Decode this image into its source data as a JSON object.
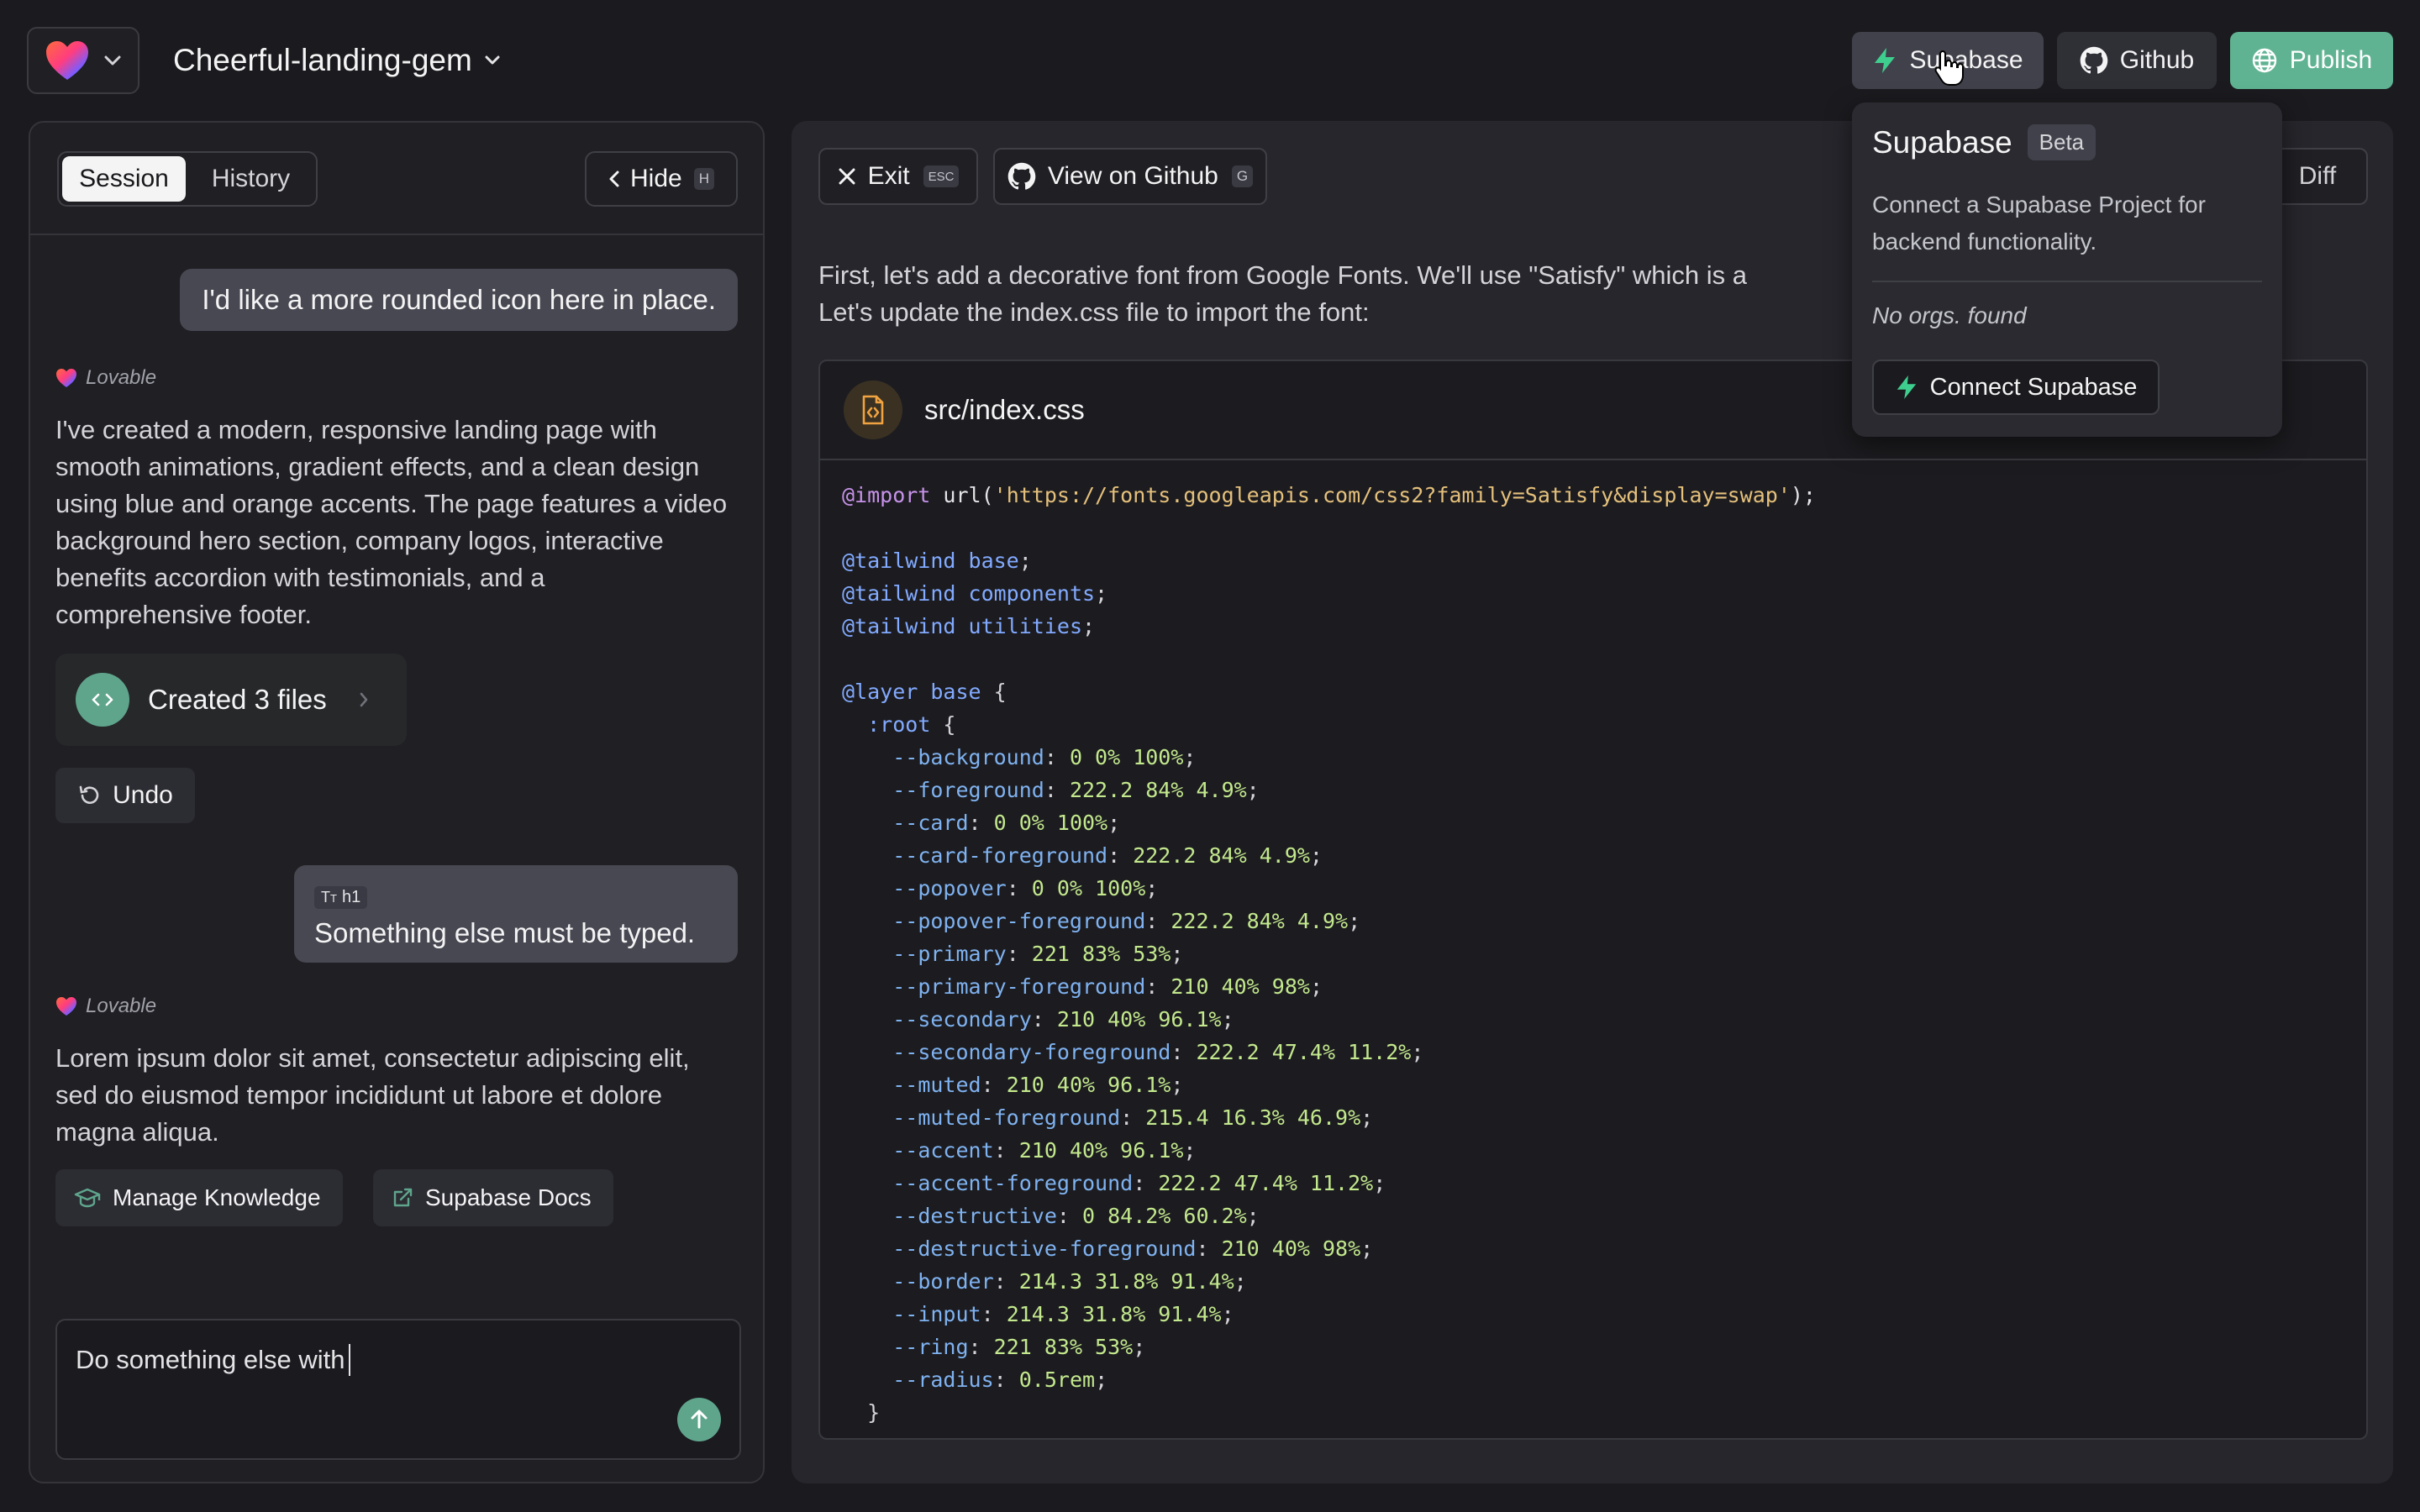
{
  "header": {
    "project_name": "Cheerful-landing-gem",
    "supabase_label": "Supabase",
    "github_label": "Github",
    "publish_label": "Publish"
  },
  "left_panel": {
    "tabs": [
      {
        "label": "Session",
        "active": true
      },
      {
        "label": "History",
        "active": false
      }
    ],
    "hide_label": "Hide",
    "hide_shortcut": "H",
    "messages": {
      "user1": "I'd like a more rounded icon here in place.",
      "sender1": "Lovable",
      "assistant1": "I've created a modern, responsive landing page with smooth animations, gradient effects, and a clean design using blue and orange accents. The  page features a video background hero section, company logos, interactive benefits accordion with testimonials, and a comprehensive footer.",
      "files_card": "Created 3 files",
      "undo_label": "Undo",
      "user2_tag": "h1",
      "user2": "Something else must be typed.",
      "sender2": "Lovable",
      "assistant2": "Lorem ipsum dolor sit amet, consectetur adipiscing elit, sed do eiusmod tempor incididunt ut labore et dolore magna aliqua.",
      "chip_knowledge": "Manage Knowledge",
      "chip_docs": "Supabase Docs"
    },
    "input": {
      "value": "Do something else with"
    }
  },
  "right_panel": {
    "exit_label": "Exit",
    "exit_shortcut": "ESC",
    "view_github_label": "View on Github",
    "view_github_shortcut": "G",
    "diff_label": "Diff",
    "intro_line1": "First, let's add a decorative font from Google Fonts. We'll use \"Satisfy\" which is a",
    "intro_line2": "Let's update the index.css file to import the font:",
    "file_name": "src/index.css",
    "code": {
      "import_url": "'https://fonts.googleapis.com/css2?family=Satisfy&display=swap'",
      "tailwind": [
        "base",
        "components",
        "utilities"
      ],
      "layer": "base",
      "selector": ":root",
      "vars": [
        {
          "name": "--background",
          "value": "0 0% 100%"
        },
        {
          "name": "--foreground",
          "value": "222.2 84% 4.9%"
        },
        {
          "name": "--card",
          "value": "0 0% 100%"
        },
        {
          "name": "--card-foreground",
          "value": "222.2 84% 4.9%"
        },
        {
          "name": "--popover",
          "value": "0 0% 100%"
        },
        {
          "name": "--popover-foreground",
          "value": "222.2 84% 4.9%"
        },
        {
          "name": "--primary",
          "value": "221 83% 53%"
        },
        {
          "name": "--primary-foreground",
          "value": "210 40% 98%"
        },
        {
          "name": "--secondary",
          "value": "210 40% 96.1%"
        },
        {
          "name": "--secondary-foreground",
          "value": "222.2 47.4% 11.2%"
        },
        {
          "name": "--muted",
          "value": "210 40% 96.1%"
        },
        {
          "name": "--muted-foreground",
          "value": "215.4 16.3% 46.9%"
        },
        {
          "name": "--accent",
          "value": "210 40% 96.1%"
        },
        {
          "name": "--accent-foreground",
          "value": "222.2 47.4% 11.2%"
        },
        {
          "name": "--destructive",
          "value": "0 84.2% 60.2%"
        },
        {
          "name": "--destructive-foreground",
          "value": "210 40% 98%"
        },
        {
          "name": "--border",
          "value": "214.3 31.8% 91.4%"
        },
        {
          "name": "--input",
          "value": "214.3 31.8% 91.4%"
        },
        {
          "name": "--ring",
          "value": "221 83% 53%"
        },
        {
          "name": "--radius",
          "value": "0.5rem"
        }
      ]
    }
  },
  "popover": {
    "title": "Supabase",
    "badge": "Beta",
    "description": "Connect a Supabase Project for backend functionality.",
    "empty_state": "No orgs. found",
    "connect_label": "Connect Supabase"
  },
  "colors": {
    "background": "#1b1b1f",
    "accent_green": "#5fb392",
    "supabase_green": "#3ecf8e"
  }
}
